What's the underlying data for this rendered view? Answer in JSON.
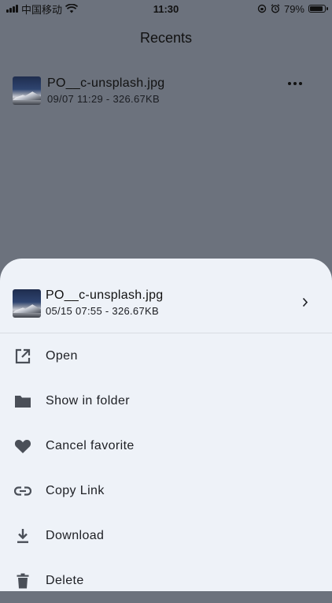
{
  "status_bar": {
    "carrier": "中国移动",
    "time": "11:30",
    "battery": "79%",
    "battery_level": 0.79
  },
  "page": {
    "title": "Recents"
  },
  "recent_file": {
    "name": "PO__c-unsplash.jpg",
    "meta": "09/07 11:29 - 326.67KB"
  },
  "sheet": {
    "file": {
      "name": "PO__c-unsplash.jpg",
      "meta": "05/15 07:55 - 326.67KB"
    },
    "actions": [
      {
        "label": "Open",
        "icon": "open-external-icon"
      },
      {
        "label": "Show in folder",
        "icon": "folder-icon"
      },
      {
        "label": "Cancel favorite",
        "icon": "heart-icon"
      },
      {
        "label": "Copy Link",
        "icon": "link-icon"
      },
      {
        "label": "Download",
        "icon": "download-icon"
      },
      {
        "label": "Delete",
        "icon": "trash-icon"
      }
    ]
  }
}
